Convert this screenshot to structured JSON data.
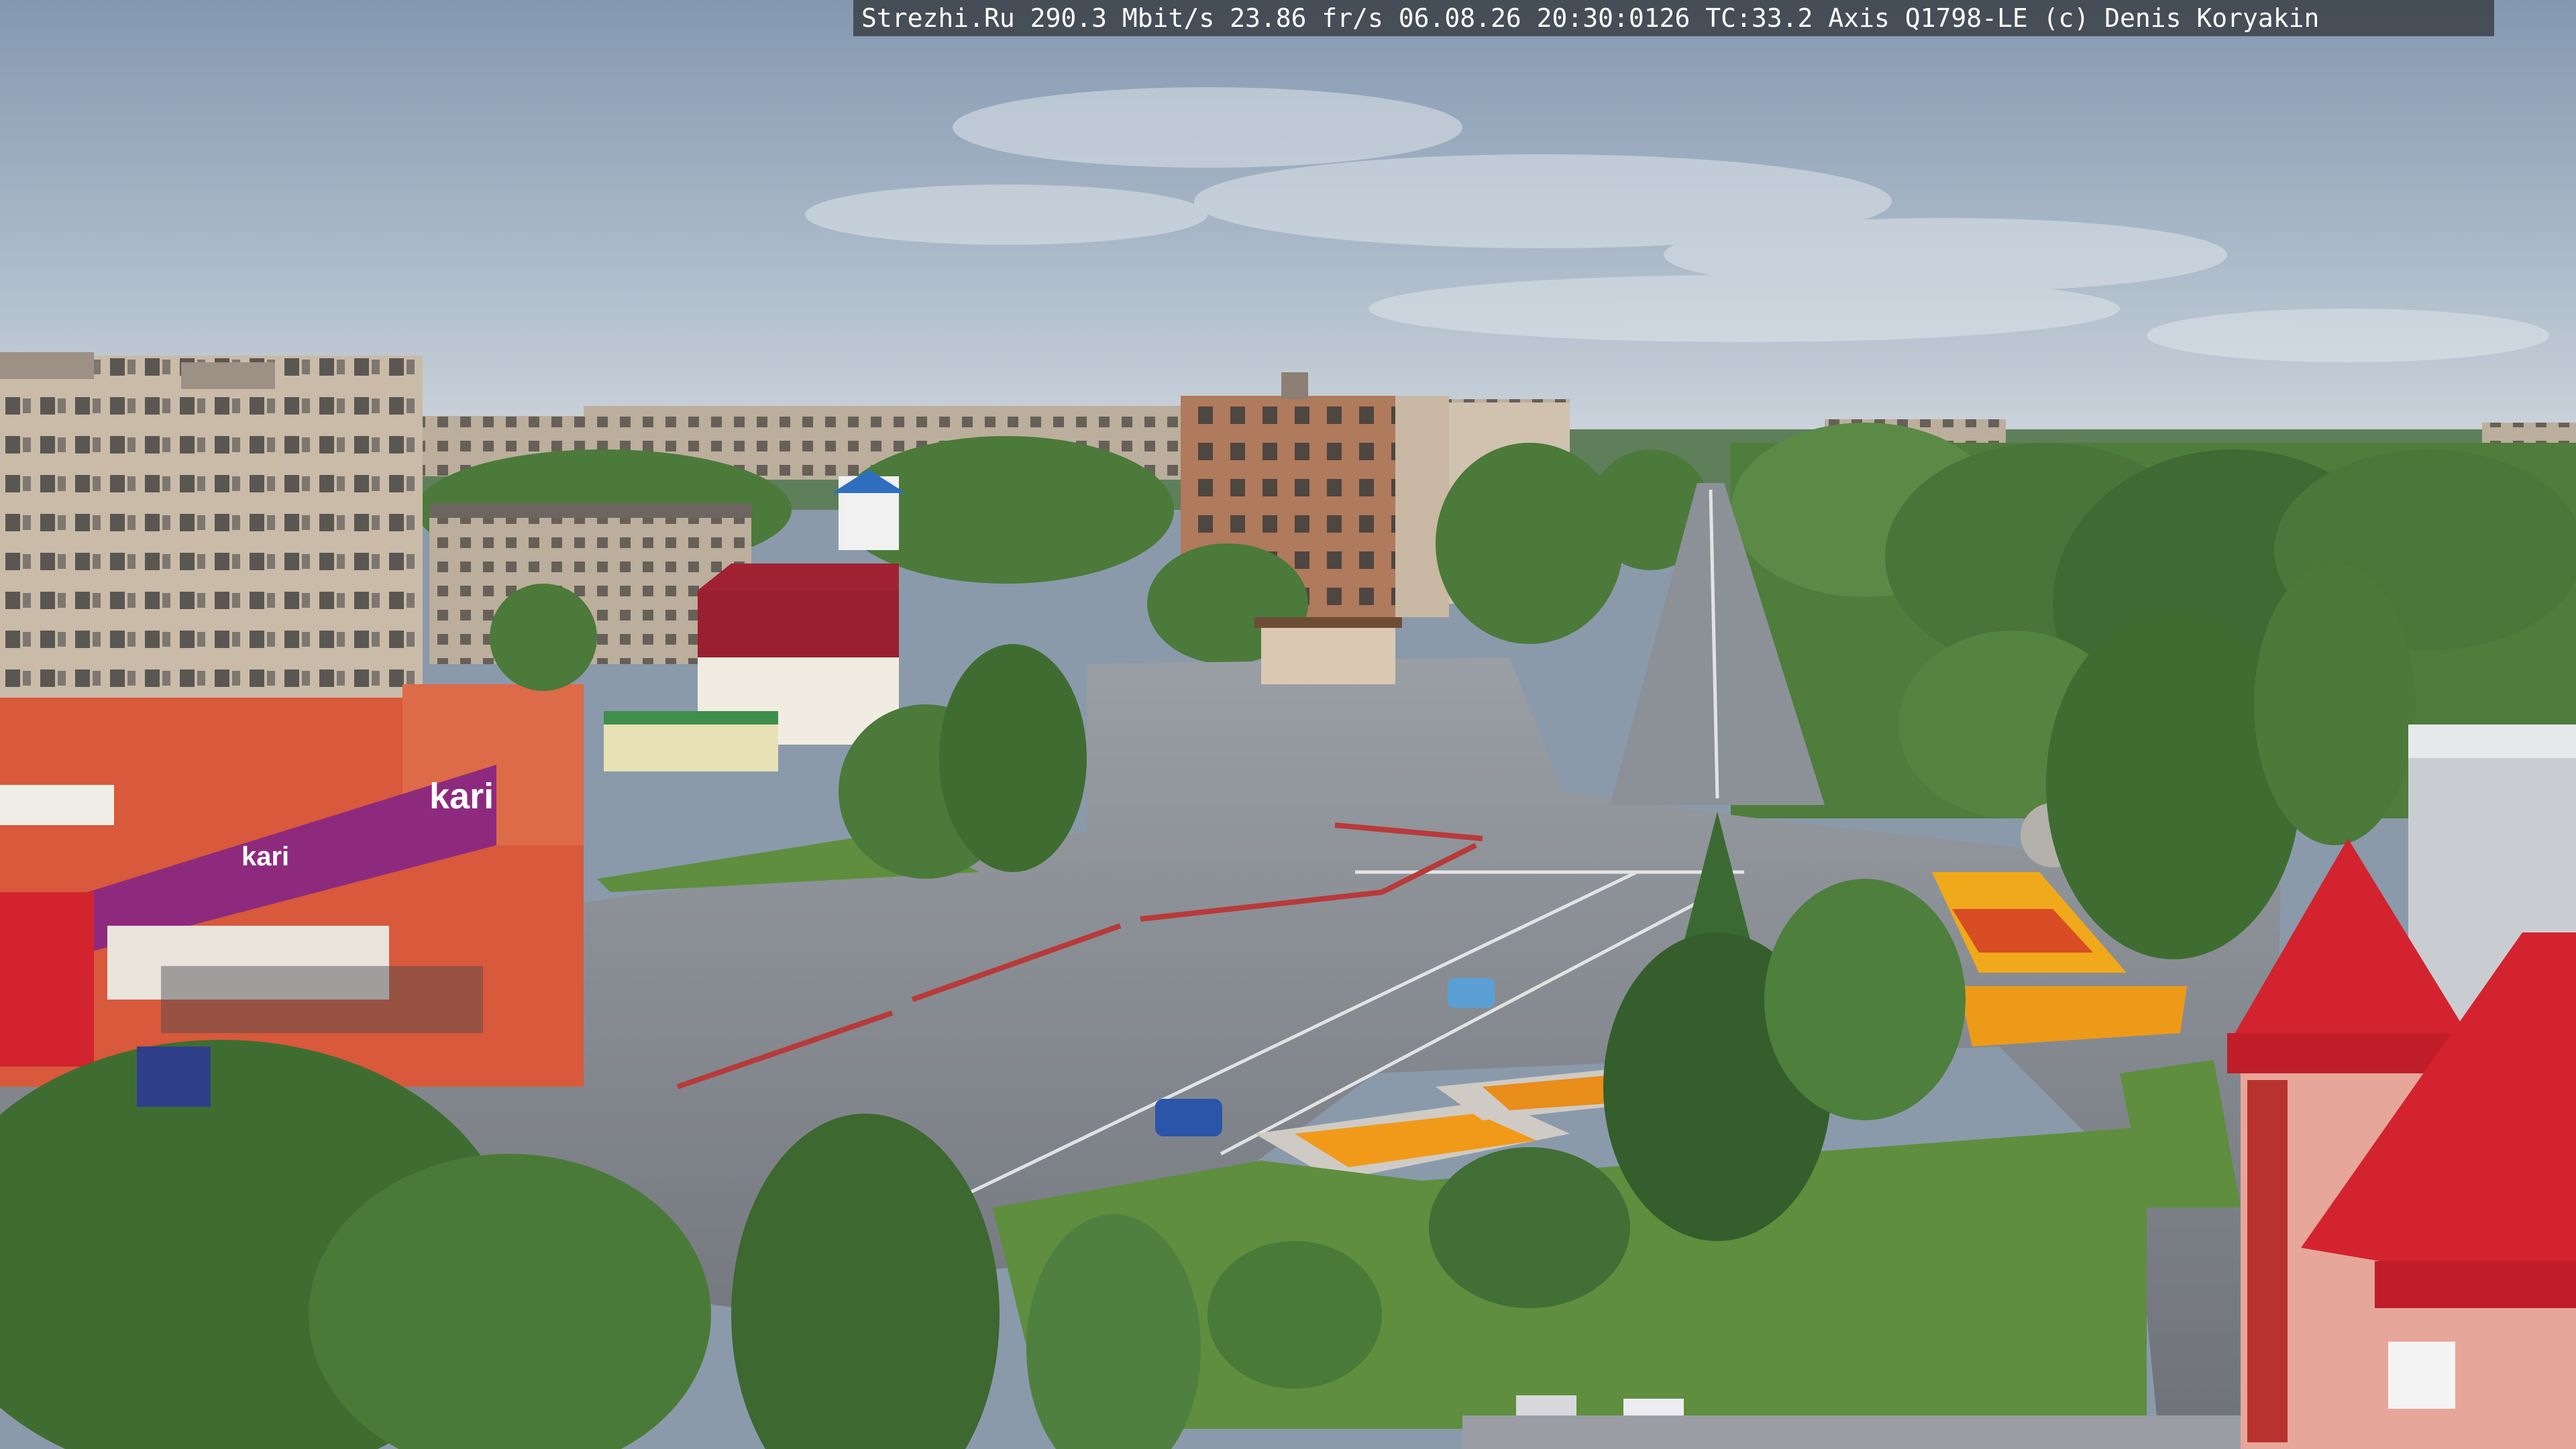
{
  "overlay": {
    "text": "Strezhi.Ru 290.3 Mbit/s 23.86 fr/s 06.08.26 20:30:0126 TC:33.2  Axis Q1798-LE  (c) Denis Koryakin"
  },
  "signs": {
    "kari_logo": "kari",
    "kari_small": "kari"
  },
  "colors": {
    "sky_top": "#8ea2b8",
    "sky_bottom": "#c9d2db",
    "asphalt": "#6f7378",
    "tree": "#4f7d3c",
    "tree_dark": "#355e2c",
    "roof_red": "#d3232e",
    "store_purple": "#8e2a7e",
    "store_orange": "#d8593b",
    "panel_building": "#c7b8a6"
  }
}
